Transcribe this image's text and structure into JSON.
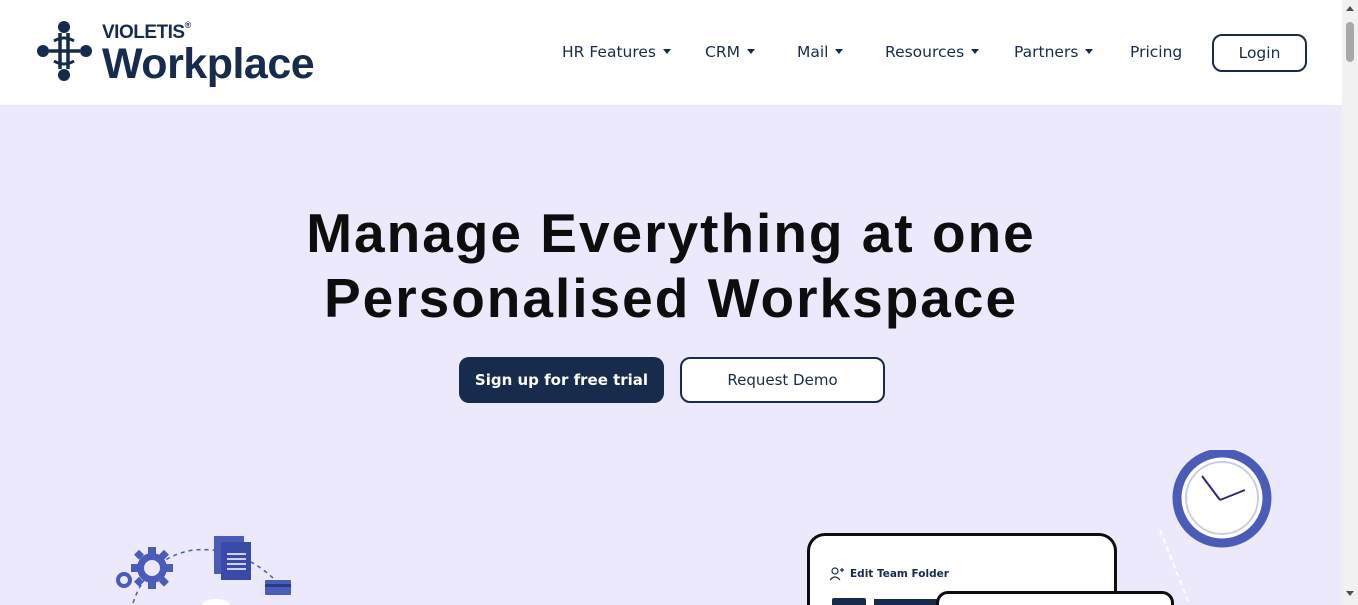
{
  "brand": {
    "company": "VIOLETIS",
    "registered_mark": "®",
    "product": "Workplace",
    "logo_icon": "people-network-icon"
  },
  "nav": {
    "items": [
      {
        "label": "HR Features",
        "has_dropdown": true
      },
      {
        "label": "CRM",
        "has_dropdown": true
      },
      {
        "label": "Mail",
        "has_dropdown": true
      },
      {
        "label": "Resources",
        "has_dropdown": true
      },
      {
        "label": "Partners",
        "has_dropdown": true
      },
      {
        "label": "Pricing",
        "has_dropdown": false
      }
    ],
    "login_label": "Login"
  },
  "hero": {
    "title_line1": "Manage Everything at one",
    "title_line2": "Personalised Workspace",
    "primary_cta": "Sign up for free trial",
    "secondary_cta": "Request Demo"
  },
  "illustration": {
    "card_label": "Edit Team Folder",
    "icons": [
      "gear-icon",
      "document-icon",
      "credit-card-icon",
      "clock-icon",
      "add-user-icon",
      "folder-icon"
    ]
  },
  "colors": {
    "primary": "#172b4d",
    "hero_bg": "#ebe9fb",
    "accent": "#4b5bb8"
  }
}
